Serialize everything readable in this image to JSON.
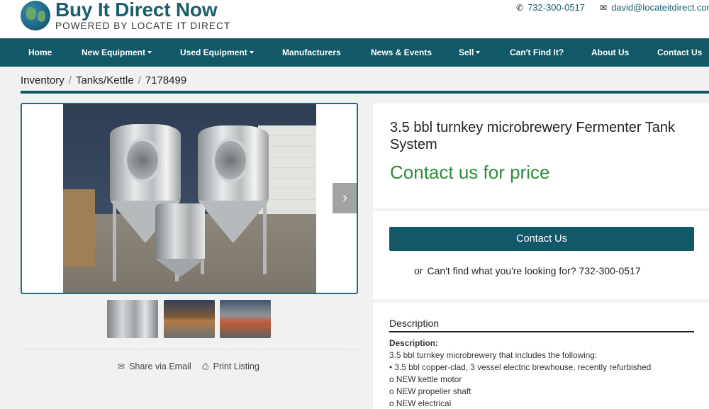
{
  "header": {
    "brand_title": "Buy It Direct Now",
    "brand_subtitle": "POWERED BY LOCATE IT DIRECT",
    "phone": "732-300-0517",
    "email": "david@locateitdirect.com"
  },
  "nav": {
    "items": [
      {
        "label": "Home",
        "dropdown": false
      },
      {
        "label": "New Equipment",
        "dropdown": true
      },
      {
        "label": "Used Equipment",
        "dropdown": true
      },
      {
        "label": "Manufacturers",
        "dropdown": false
      },
      {
        "label": "News & Events",
        "dropdown": false
      },
      {
        "label": "Sell",
        "dropdown": true
      },
      {
        "label": "Can't Find It?",
        "dropdown": false
      },
      {
        "label": "About Us",
        "dropdown": false
      },
      {
        "label": "Contact Us",
        "dropdown": false
      }
    ]
  },
  "breadcrumb": {
    "items": [
      "Inventory",
      "Tanks/Kettle",
      "7178499"
    ]
  },
  "gallery": {
    "next_icon": "chevron-right-icon",
    "thumbnail_count": 3
  },
  "actions": {
    "share_label": "Share via Email",
    "print_label": "Print Listing"
  },
  "product": {
    "title": "3.5 bbl turnkey microbrewery Fermenter Tank System",
    "price_text": "Contact us for price",
    "price_color": "#2e8b3a"
  },
  "cta": {
    "button_label": "Contact Us",
    "or_text": "or",
    "cant_find_text": "Can't find what you're looking for?",
    "phone": "732-300-0517"
  },
  "description": {
    "heading": "Description",
    "label": "Description:",
    "lines": [
      "3.5 bbl turnkey microbrewery that includes the following:",
      "• 3.5 bbl copper-clad, 3 vessel electric brewhouse, recently refurbished",
      "o NEW kettle motor",
      "o NEW propeller shaft",
      "o NEW electrical"
    ]
  },
  "colors": {
    "brand": "#125868",
    "price_green": "#2e8b3a"
  }
}
